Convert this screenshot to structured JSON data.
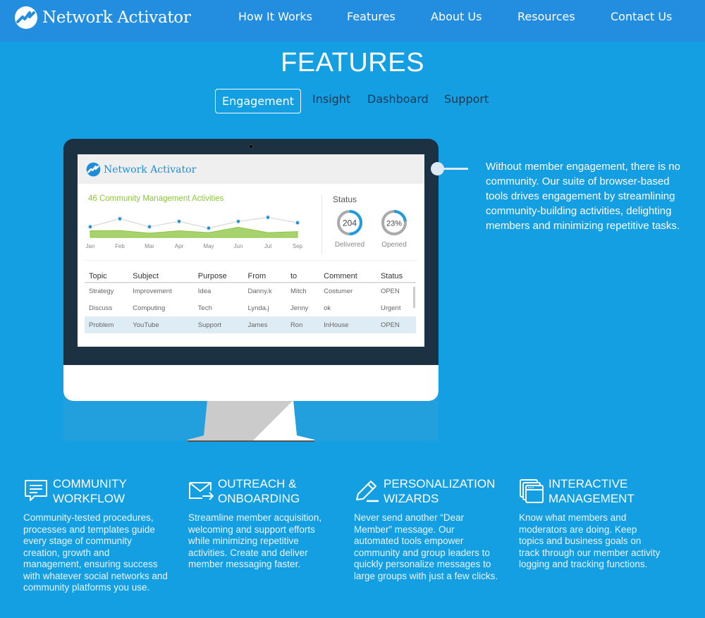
{
  "header": {
    "brand": "Network Activator",
    "nav": [
      {
        "label": "How It Works"
      },
      {
        "label": "Features"
      },
      {
        "label": "About Us"
      },
      {
        "label": "Resources"
      },
      {
        "label": "Contact Us"
      }
    ]
  },
  "features_section": {
    "title": "FEATURES",
    "tabs": [
      {
        "label": "Engagement",
        "active": true
      },
      {
        "label": "Insight",
        "active": false
      },
      {
        "label": "Dashboard",
        "active": false
      },
      {
        "label": "Support",
        "active": false
      }
    ],
    "description": "Without member engagement, there is no community. Our suite of browser-based tools drives engagement by streamlining community-building activities, delighting members and minimizing repetitive tasks."
  },
  "dashboard_mockup": {
    "brand": "Network Activator",
    "activity_title": "46 Community Management Activities",
    "chart_data": {
      "type": "line",
      "title": "46 Community Management Activities",
      "categories": [
        "Jan",
        "Feb",
        "Mar",
        "Apr",
        "May",
        "Jun",
        "Jul",
        "Sep"
      ],
      "series": [
        {
          "name": "line",
          "values": [
            4,
            7,
            4,
            6,
            3.5,
            6,
            7.5,
            5.5
          ]
        },
        {
          "name": "area",
          "values": [
            2.5,
            2.6,
            1.6,
            2.5,
            1.8,
            3.8,
            1.8,
            2.2
          ]
        }
      ],
      "ylim": [
        0,
        10
      ]
    },
    "status": {
      "title": "Status",
      "gauges": [
        {
          "value": "204",
          "label": "Delivered",
          "fraction": 0.5
        },
        {
          "value": "23%",
          "label": "Opened",
          "fraction": 0.23
        }
      ]
    },
    "table": {
      "columns": [
        "Topic",
        "Subject",
        "Purpose",
        "From",
        "to",
        "Comment",
        "Status"
      ],
      "rows": [
        [
          "Strategy",
          "Improvement",
          "Idea",
          "Danny.k",
          "Mitch",
          "Costumer",
          "OPEN"
        ],
        [
          "Discuss",
          "Computing",
          "Tech",
          "Lynda.j",
          "Jenny",
          "ok",
          "Urgent"
        ],
        [
          "Problem",
          "YouTube",
          "Support",
          "James",
          "Ron",
          "InHouse",
          "OPEN"
        ]
      ],
      "selected_row": 2
    }
  },
  "feature_cards": [
    {
      "icon": "chat-document-icon",
      "title": "Community Workflow",
      "body": "Community-tested procedures, processes and templates guide every stage of community creation, growth and management, ensuring success with whatever social networks and community platforms you use."
    },
    {
      "icon": "envelope-arrow-icon",
      "title": "Outreach & Onboarding",
      "body": "Streamline member acquisition, welcoming and support efforts while minimizing repetitive activities. Create and deliver member messaging faster."
    },
    {
      "icon": "pencil-icon",
      "title": "Personalization Wizards",
      "body": "Never send another “Dear Member” message. Our automated tools empower community and group leaders to quickly personalize messages to large groups with just a few clicks."
    },
    {
      "icon": "stacked-windows-icon",
      "title": "Interactive Management",
      "body": "Know what members and moderators are doing. Keep topics and business goals on track through our member activity logging and tracking functions."
    }
  ],
  "colors": {
    "header_bg": "#238ee0",
    "page_bg": "#139fe2",
    "chart_green": "#8cc63f",
    "chart_blue": "#1f8ed8",
    "monitor_dark": "#1c3142"
  }
}
